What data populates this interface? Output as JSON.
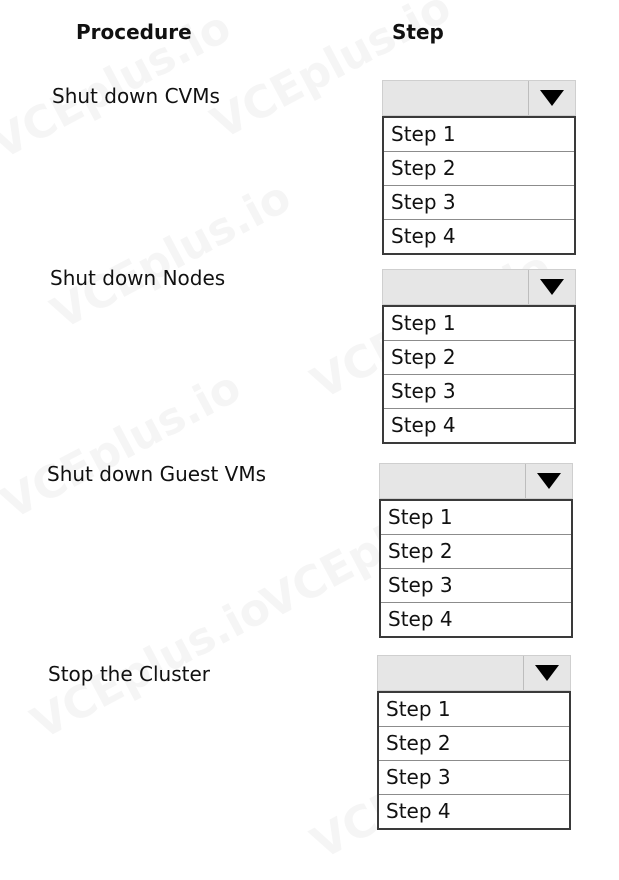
{
  "headers": {
    "procedure": "Procedure",
    "step": "Step"
  },
  "procedures": [
    {
      "label": "Shut  down CVMs",
      "selected": "",
      "options": [
        "Step 1",
        "Step 2",
        "Step 3",
        "Step 4"
      ]
    },
    {
      "label": "Shut down Nodes",
      "selected": "",
      "options": [
        "Step 1",
        "Step 2",
        "Step 3",
        "Step 4"
      ]
    },
    {
      "label": "Shut down Guest VMs",
      "selected": "",
      "options": [
        "Step 1",
        "Step 2",
        "Step 3",
        "Step 4"
      ]
    },
    {
      "label": "Stop the Cluster",
      "selected": "",
      "options": [
        "Step 1",
        "Step 2",
        "Step 3",
        "Step 4"
      ]
    }
  ],
  "watermark": "VCEplus.io"
}
